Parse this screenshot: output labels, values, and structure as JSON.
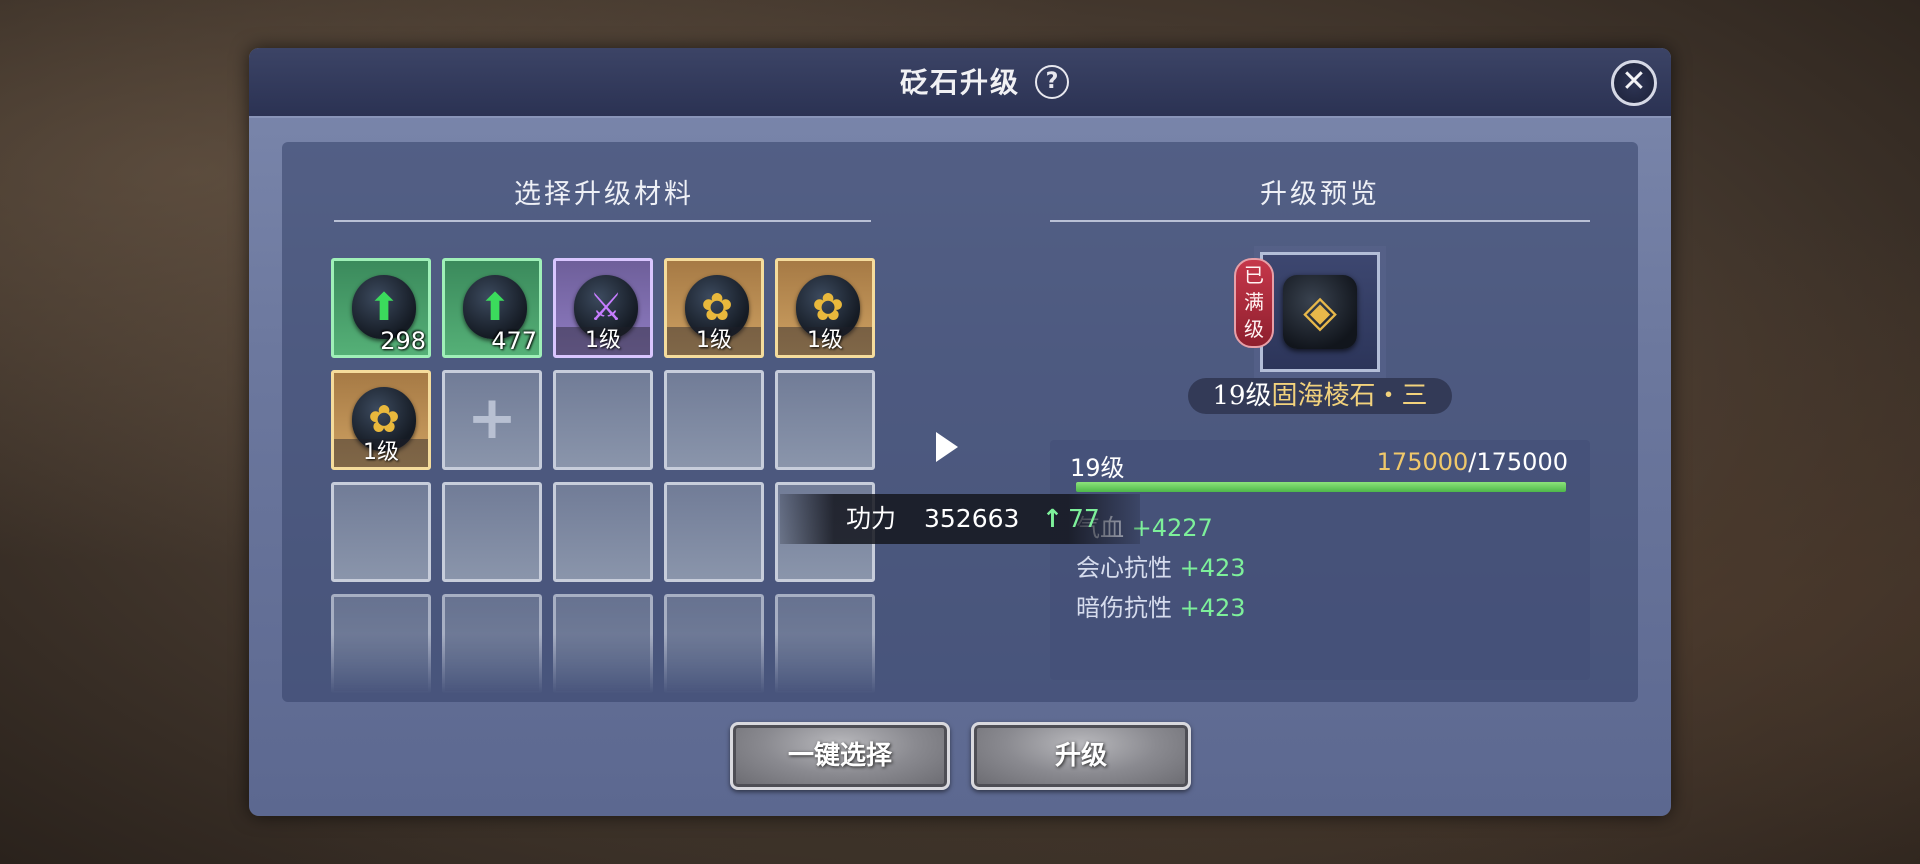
{
  "dialog": {
    "title": "砭石升级",
    "help_glyph": "?",
    "close_glyph": "✕"
  },
  "materials": {
    "title": "选择升级材料",
    "slots": [
      {
        "variant": "green",
        "icon": "green-up-arrow-stone-icon",
        "glyph": "⬆",
        "glyph_color": "#3bdb5c",
        "count": "298"
      },
      {
        "variant": "green",
        "icon": "green-up-arrow-stone-icon",
        "glyph": "⬆",
        "glyph_color": "#3bdb5c",
        "count": "477"
      },
      {
        "variant": "purple",
        "icon": "purple-sword-stone-icon",
        "glyph": "⚔",
        "glyph_color": "#c77dff",
        "label": "1级"
      },
      {
        "variant": "gold",
        "icon": "gold-lotus-stone-icon",
        "glyph": "✿",
        "glyph_color": "#e9b83c",
        "label": "1级"
      },
      {
        "variant": "gold",
        "icon": "gold-lotus-stone-icon",
        "glyph": "✿",
        "glyph_color": "#e9b83c",
        "label": "1级"
      },
      {
        "variant": "gold",
        "icon": "gold-lotus-stone-icon",
        "glyph": "✿",
        "glyph_color": "#e9b83c",
        "label": "1级"
      },
      {
        "variant": "add",
        "plus": "+"
      }
    ]
  },
  "preview": {
    "title": "升级预览",
    "maxed_badge": "已满级",
    "item_level": "19级",
    "item_name": "固海棱石・三",
    "level_label": "19级",
    "exp_current": "175000",
    "exp_separator": "/",
    "exp_max": "175000",
    "exp_fraction": 1.0,
    "stats": [
      {
        "name": "气血",
        "value": "+4227"
      },
      {
        "name": "会心抗性",
        "value": "+423"
      },
      {
        "name": "暗伤抗性",
        "value": "+423"
      }
    ],
    "icon": "shield-drop-gem-icon"
  },
  "power_tip": {
    "label": "功力",
    "value": "352663",
    "arrow": "↑",
    "delta": "77"
  },
  "buttons": {
    "auto_select": "一键选择",
    "upgrade": "升级"
  }
}
